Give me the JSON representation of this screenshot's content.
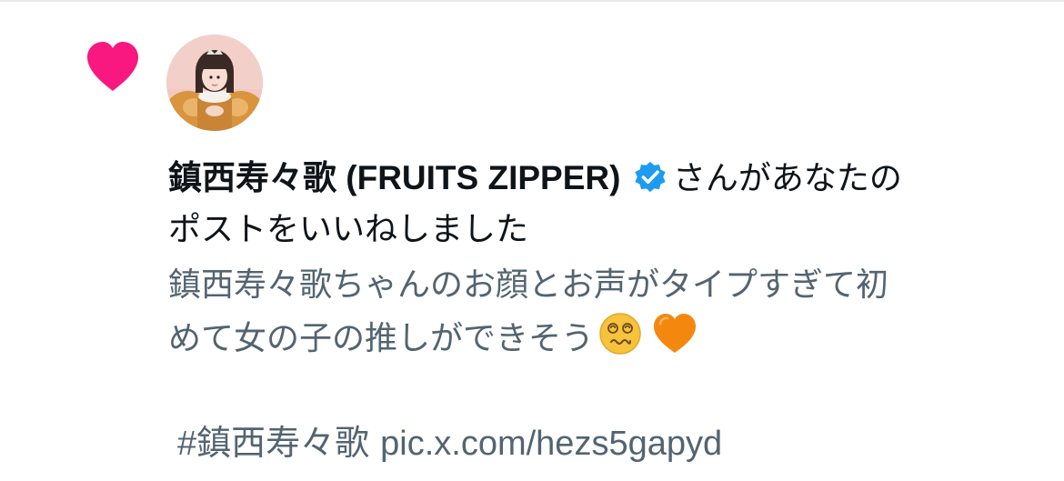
{
  "notification": {
    "type_icon": "heart-icon",
    "accent_color": "#f91880",
    "verified_color": "#1d9bf0",
    "avatar": "user-avatar-photo",
    "user_name": "鎮西寿々歌 (FRUITS ZIPPER)",
    "action_text_line1": "さんがあなたの",
    "action_text_line2": "ポストをいいねしました"
  },
  "post_preview": {
    "line1": "鎮西寿々歌ちゃんのお顔とお声がタイプすぎて初",
    "line2": "めて女の子の推しができそう",
    "emojis": [
      "face-with-spiral-eyes-emoji",
      "orange-heart-emoji"
    ],
    "hashtag": "#鎮西寿々歌",
    "link": "pic.x.com/hezs5gapyd"
  }
}
